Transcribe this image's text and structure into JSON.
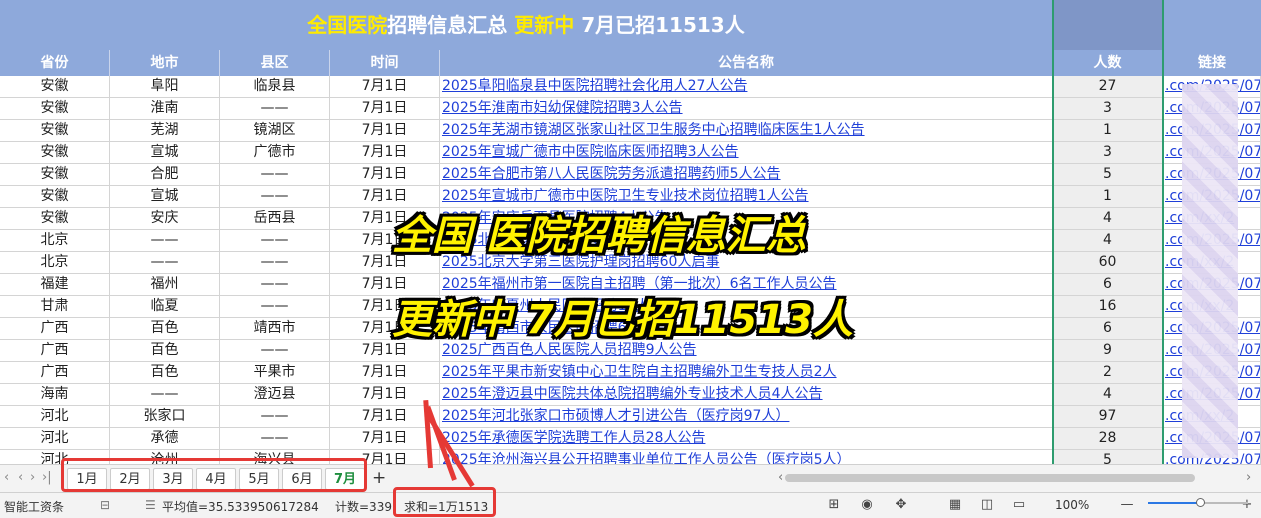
{
  "title": {
    "part1": "全国医院",
    "part2": "招聘信息汇总 ",
    "part3": "更新中",
    "part4": " 7月已招11513人"
  },
  "headers": [
    "省份",
    "地市",
    "县区",
    "时间",
    "公告名称",
    "人数",
    "链接"
  ],
  "rows": [
    {
      "prov": "安徽",
      "city": "阜阳",
      "county": "临泉县",
      "date": "7月1日",
      "title": "2025阜阳临泉县中医院招聘社会化用人27人公告",
      "n": "27",
      "url": ".com/2025/07"
    },
    {
      "prov": "安徽",
      "city": "淮南",
      "county": "——",
      "date": "7月1日",
      "title": "2025年淮南市妇幼保健院招聘3人公告",
      "n": "3",
      "url": ".com/2025/07"
    },
    {
      "prov": "安徽",
      "city": "芜湖",
      "county": "镜湖区",
      "date": "7月1日",
      "title": "2025年芜湖市镜湖区张家山社区卫生服务中心招聘临床医生1人公告",
      "n": "1",
      "url": ".com/2025/07"
    },
    {
      "prov": "安徽",
      "city": "宣城",
      "county": "广德市",
      "date": "7月1日",
      "title": "2025年宣城广德市中医院临床医师招聘3人公告",
      "n": "3",
      "url": ".com/2025/07"
    },
    {
      "prov": "安徽",
      "city": "合肥",
      "county": "——",
      "date": "7月1日",
      "title": "2025年合肥市第八人民医院劳务派遣招聘药师5人公告",
      "n": "5",
      "url": ".com/2025/07"
    },
    {
      "prov": "安徽",
      "city": "宣城",
      "county": "——",
      "date": "7月1日",
      "title": "2025年宣城市广德市中医院卫生专业技术岗位招聘1人公告",
      "n": "1",
      "url": ".com/2025/07"
    },
    {
      "prov": "安徽",
      "city": "安庆",
      "county": "岳西县",
      "date": "7月1日",
      "title": "2025年安庆岳西县医院招聘4人公告",
      "n": "4",
      "url": ".com/xx/2"
    },
    {
      "prov": "北京",
      "city": "——",
      "county": "——",
      "date": "7月1日",
      "title": "2025北京市医院招聘4人公告",
      "n": "4",
      "url": ".com/2025/07"
    },
    {
      "prov": "北京",
      "city": "——",
      "county": "——",
      "date": "7月1日",
      "title": "2025北京大学第三医院护理岗招聘60人启事",
      "n": "60",
      "url": ".com/xx/2"
    },
    {
      "prov": "福建",
      "city": "福州",
      "county": "——",
      "date": "7月1日",
      "title": "2025年福州市第一医院自主招聘（第一批次）6名工作人员公告",
      "n": "6",
      "url": ".com/2025/07"
    },
    {
      "prov": "甘肃",
      "city": "临夏",
      "county": "——",
      "date": "7月1日",
      "title": "2025年临夏州人民医院招聘16人公告",
      "n": "16",
      "url": ".com/xx/2"
    },
    {
      "prov": "广西",
      "city": "百色",
      "county": "靖西市",
      "date": "7月1日",
      "title": "2025年靖西市人民医院招聘6人公告",
      "n": "6",
      "url": ".com/2025/07"
    },
    {
      "prov": "广西",
      "city": "百色",
      "county": "——",
      "date": "7月1日",
      "title": "2025广西百色人民医院人员招聘9人公告",
      "n": "9",
      "url": ".com/2025/07"
    },
    {
      "prov": "广西",
      "city": "百色",
      "county": "平果市",
      "date": "7月1日",
      "title": "2025年平果市新安镇中心卫生院自主招聘编外卫生专技人员2人",
      "n": "2",
      "url": ".com/2025/07"
    },
    {
      "prov": "海南",
      "city": "——",
      "county": "澄迈县",
      "date": "7月1日",
      "title": "2025年澄迈县中医院共体总院招聘编外专业技术人员4人公告",
      "n": "4",
      "url": ".com/2025/07"
    },
    {
      "prov": "河北",
      "city": "张家口",
      "county": "——",
      "date": "7月1日",
      "title": "2025年河北张家口市硕博人才引进公告（医疗岗97人）",
      "n": "97",
      "url": ".com/xx/2"
    },
    {
      "prov": "河北",
      "city": "承德",
      "county": "——",
      "date": "7月1日",
      "title": "2025年承德医学院选聘工作人员28人公告",
      "n": "28",
      "url": ".com/2025/07"
    },
    {
      "prov": "河北",
      "city": "沧州",
      "county": "海兴县",
      "date": "7月1日",
      "title": "2025年沧州海兴县公开招聘事业单位工作人员公告（医疗岗5人）",
      "n": "5",
      "url": ".com/2025/07"
    }
  ],
  "overlay": {
    "line1": "全国 医院招聘信息汇总",
    "line2": "更新中 7月已招11513人"
  },
  "tabs": [
    "1月",
    "2月",
    "3月",
    "4月",
    "5月",
    "6月",
    "7月"
  ],
  "active_tab": "7月",
  "add_tab": "+",
  "status": {
    "app": "智能工资条",
    "avg": "平均值=35.533950617284",
    "count": "计数=339",
    "sum": "求和=1万1513",
    "zoom": "100%"
  },
  "colors": {
    "header_bg": "#8ea9db",
    "title_yellow": "#ffeb00",
    "link": "#1f3fd8",
    "highlight_red": "#e53935",
    "selection_green": "#2e9c6f"
  }
}
